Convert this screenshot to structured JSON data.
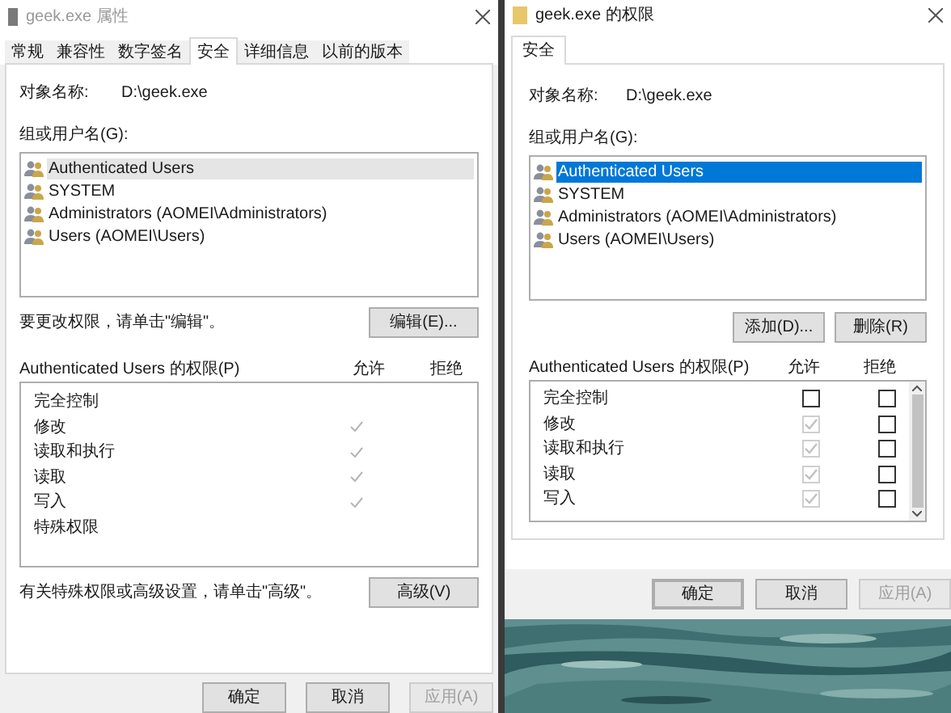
{
  "left_window": {
    "title": "geek.exe 属性",
    "tabs": [
      {
        "label": "常规",
        "selected": false
      },
      {
        "label": "兼容性",
        "selected": false
      },
      {
        "label": "数字签名",
        "selected": false
      },
      {
        "label": "安全",
        "selected": true
      },
      {
        "label": "详细信息",
        "selected": false
      },
      {
        "label": "以前的版本",
        "selected": false
      }
    ],
    "object_label": "对象名称:",
    "object_value": "D:\\geek.exe",
    "group_label": "组或用户名(G):",
    "users": [
      {
        "name": "Authenticated Users",
        "selected": true
      },
      {
        "name": "SYSTEM",
        "selected": false
      },
      {
        "name": "Administrators (AOMEI\\Administrators)",
        "selected": false
      },
      {
        "name": "Users (AOMEI\\Users)",
        "selected": false
      }
    ],
    "edit_hint": "要更改权限，请单击\"编辑\"。",
    "edit_button": "编辑(E)...",
    "perm_label": "Authenticated Users 的权限(P)",
    "allow_header": "允许",
    "deny_header": "拒绝",
    "permissions": [
      {
        "name": "完全控制",
        "allow": false
      },
      {
        "name": "修改",
        "allow": true
      },
      {
        "name": "读取和执行",
        "allow": true
      },
      {
        "name": "读取",
        "allow": true
      },
      {
        "name": "写入",
        "allow": true
      },
      {
        "name": "特殊权限",
        "allow": false
      }
    ],
    "advanced_hint": "有关特殊权限或高级设置，请单击\"高级\"。",
    "advanced_button": "高级(V)",
    "buttons": [
      {
        "label": "确定",
        "disabled": false
      },
      {
        "label": "取消",
        "disabled": false
      },
      {
        "label": "应用(A)",
        "disabled": true
      }
    ]
  },
  "right_window": {
    "title": "geek.exe 的权限",
    "tabs": [
      {
        "label": "安全",
        "selected": true
      }
    ],
    "object_label": "对象名称:",
    "object_value": "D:\\geek.exe",
    "group_label": "组或用户名(G):",
    "users": [
      {
        "name": "Authenticated Users",
        "selected": true
      },
      {
        "name": "SYSTEM",
        "selected": false
      },
      {
        "name": "Administrators (AOMEI\\Administrators)",
        "selected": false
      },
      {
        "name": "Users (AOMEI\\Users)",
        "selected": false
      }
    ],
    "add_button": "添加(D)...",
    "remove_button": "删除(R)",
    "perm_label": "Authenticated Users 的权限(P)",
    "allow_header": "允许",
    "deny_header": "拒绝",
    "permissions": [
      {
        "name": "完全控制",
        "allow": {
          "checked": false,
          "disabled": false
        },
        "deny": {
          "checked": false,
          "disabled": false
        }
      },
      {
        "name": "修改",
        "allow": {
          "checked": true,
          "disabled": true
        },
        "deny": {
          "checked": false,
          "disabled": false
        }
      },
      {
        "name": "读取和执行",
        "allow": {
          "checked": true,
          "disabled": true
        },
        "deny": {
          "checked": false,
          "disabled": false
        }
      },
      {
        "name": "读取",
        "allow": {
          "checked": true,
          "disabled": true
        },
        "deny": {
          "checked": false,
          "disabled": false
        }
      },
      {
        "name": "写入",
        "allow": {
          "checked": true,
          "disabled": true
        },
        "deny": {
          "checked": false,
          "disabled": false
        }
      }
    ],
    "buttons": [
      {
        "label": "确定",
        "disabled": false,
        "default": true
      },
      {
        "label": "取消",
        "disabled": false,
        "default": false
      },
      {
        "label": "应用(A)",
        "disabled": true,
        "default": false
      }
    ]
  }
}
